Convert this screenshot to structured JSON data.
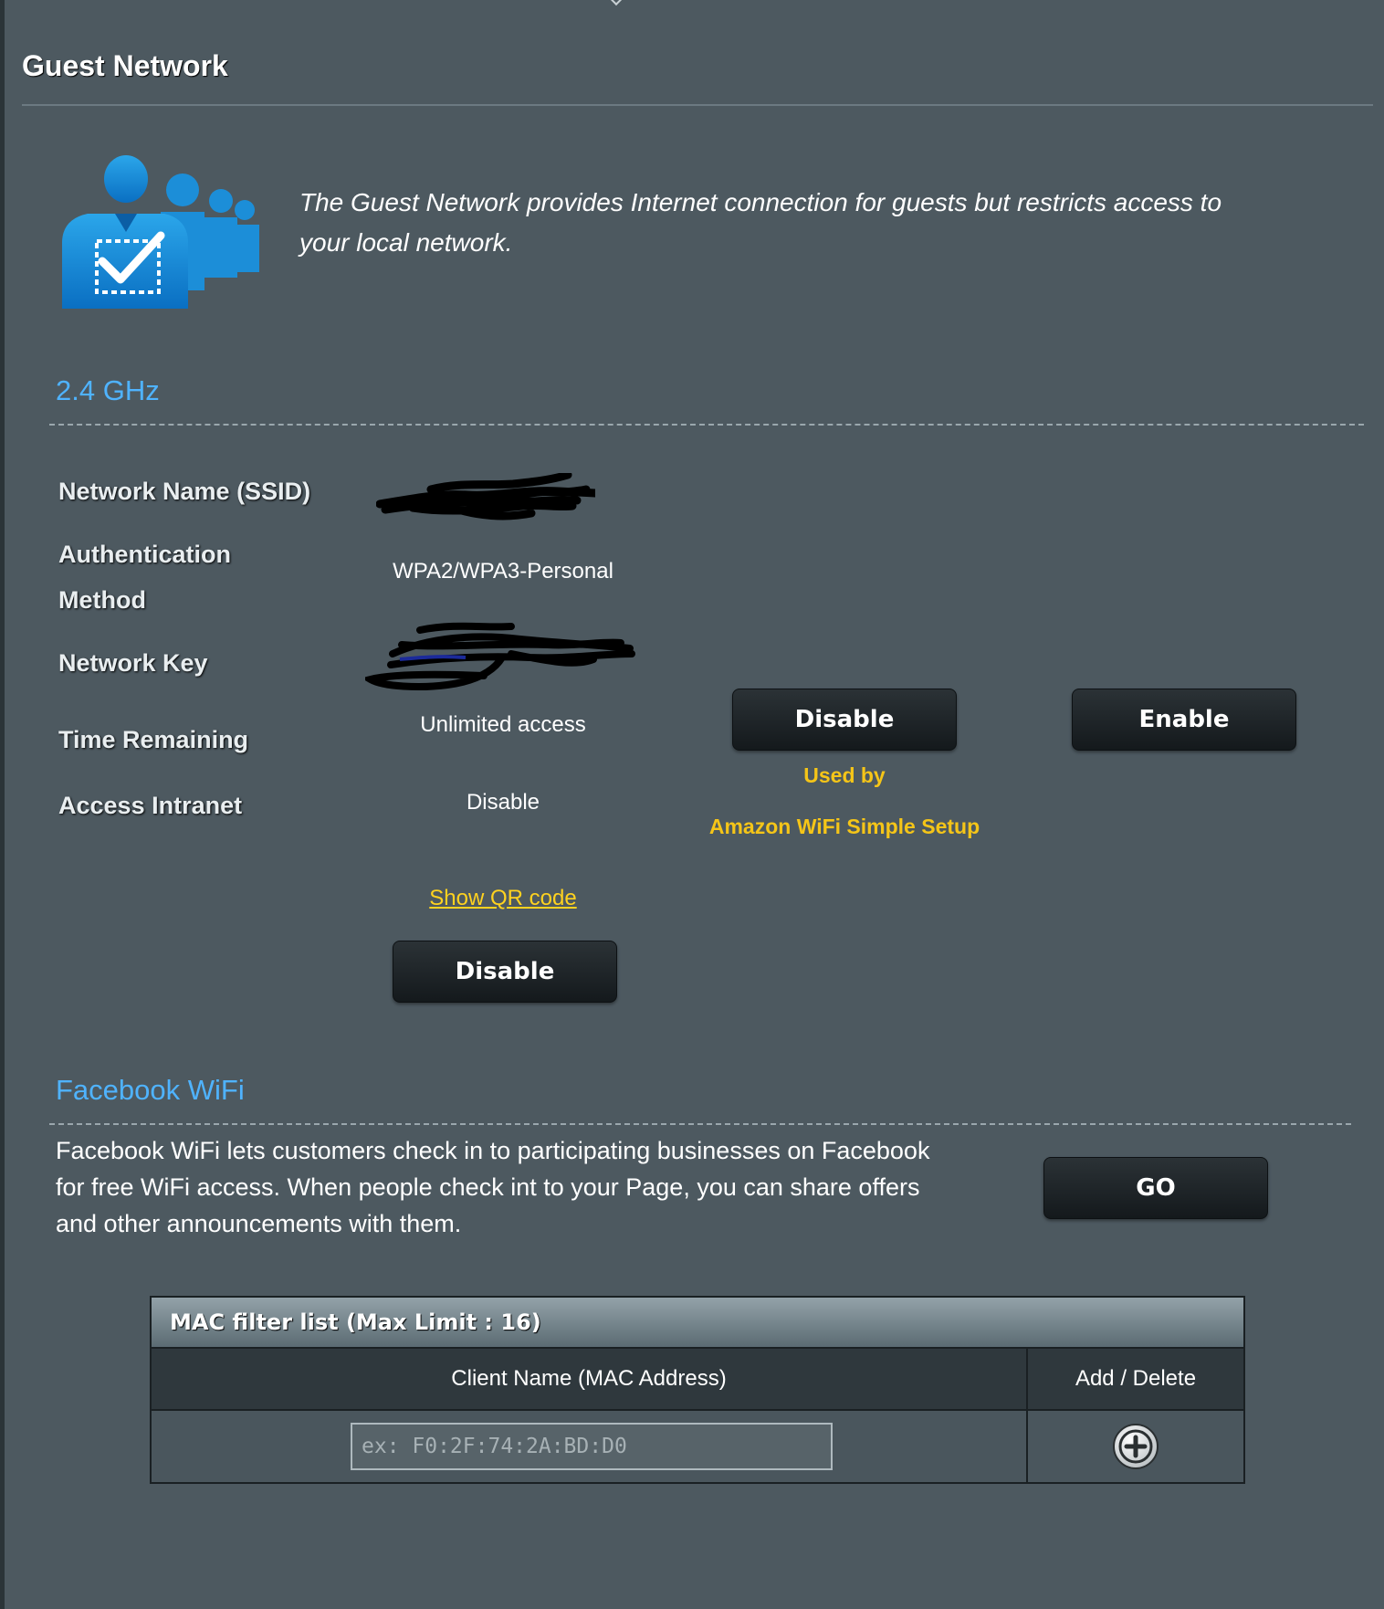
{
  "header": {
    "title": "Guest Network"
  },
  "intro": {
    "text": "The Guest Network provides Internet connection for guests but restricts access to your local network.",
    "icon": "guest-users-check-icon"
  },
  "band_24": {
    "title": "2.4 GHz",
    "labels": {
      "ssid": "Network Name (SSID)",
      "auth_line1": "Authentication",
      "auth_line2": "Method",
      "key": "Network Key",
      "time": "Time Remaining",
      "intranet": "Access Intranet"
    },
    "values": {
      "auth": "WPA2/WPA3-Personal",
      "time": "Unlimited access",
      "intranet": "Disable"
    },
    "qr_link": "Show QR code",
    "disable_button": "Disable"
  },
  "slot2": {
    "disable_button": "Disable",
    "used_by_line1": "Used by",
    "used_by_line2": "Amazon WiFi Simple Setup"
  },
  "slot3": {
    "enable_button": "Enable"
  },
  "facebook": {
    "title": "Facebook WiFi",
    "text_line1": "Facebook WiFi lets customers check in to participating businesses on Facebook",
    "text_line2": "for free WiFi access. When people check int to your Page, you can share offers",
    "text_line3": "and other announcements with them.",
    "go_button": "GO"
  },
  "mac_filter": {
    "title": "MAC filter list (Max Limit : 16)",
    "col_client": "Client Name (MAC Address)",
    "col_action": "Add / Delete",
    "input_placeholder": "ex: F0:2F:74:2A:BD:D0",
    "add_icon": "add-circle-icon"
  },
  "colors": {
    "background": "#4d5960",
    "section_title": "#4fb3ff",
    "highlight": "#f5c518",
    "button": "#1a2023"
  }
}
